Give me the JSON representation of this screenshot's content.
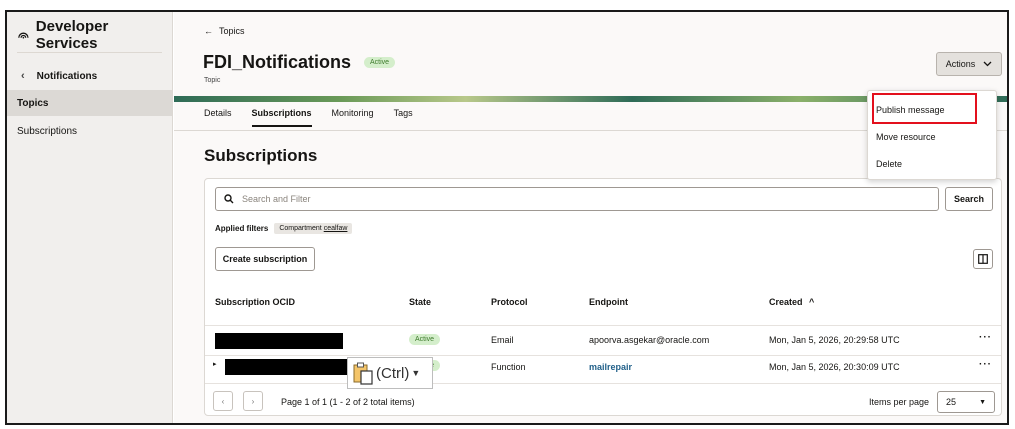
{
  "sidebar": {
    "brand": "Developer Services",
    "back_label": "Notifications",
    "items": [
      {
        "label": "Topics",
        "active": true
      },
      {
        "label": "Subscriptions",
        "active": false
      }
    ]
  },
  "header": {
    "back_link": "Topics",
    "title": "FDI_Notifications",
    "status": "Active",
    "subtitle": "Topic",
    "actions_label": "Actions"
  },
  "actions_menu": {
    "items": [
      "Publish message",
      "Move resource",
      "Delete"
    ],
    "highlighted": "Publish message"
  },
  "tabs": [
    {
      "label": "Details",
      "active": false
    },
    {
      "label": "Subscriptions",
      "active": true
    },
    {
      "label": "Monitoring",
      "active": false
    },
    {
      "label": "Tags",
      "active": false
    }
  ],
  "section": {
    "title": "Subscriptions",
    "search_placeholder": "Search and Filter",
    "search_button": "Search",
    "applied_filters_label": "Applied filters",
    "filter_chip_prefix": "Compartment",
    "filter_chip_value": "cealfaw",
    "create_button": "Create subscription"
  },
  "table": {
    "columns": [
      "Subscription OCID",
      "State",
      "Protocol",
      "Endpoint",
      "Created"
    ],
    "sort_indicator": "^",
    "rows": [
      {
        "state": "Active",
        "protocol": "Email",
        "endpoint": "apoorva.asgekar@oracle.com",
        "created": "Mon, Jan 5, 2026, 20:29:58 UTC",
        "endpoint_is_link": false
      },
      {
        "state": "Active",
        "protocol": "Function",
        "endpoint": "mailrepair",
        "created": "Mon, Jan 5, 2026, 20:30:09 UTC",
        "endpoint_is_link": true
      }
    ]
  },
  "pager": {
    "text": "Page 1 of 1 (1 - 2 of 2 total items)",
    "items_per_page_label": "Items per page",
    "items_per_page": "25"
  },
  "paste_popup": {
    "label": "(Ctrl)"
  },
  "colors": {
    "accent_green": "#3d7a2b",
    "highlight_red": "#e3101d",
    "link_blue": "#22618a"
  }
}
